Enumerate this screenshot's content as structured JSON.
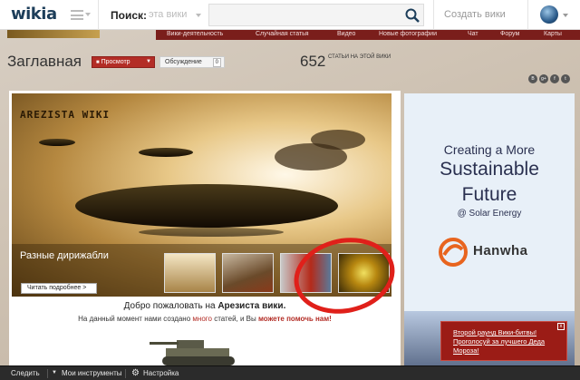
{
  "topbar": {
    "logo": "wikia",
    "search_label": "Поиск:",
    "search_scope": "эта вики",
    "search_placeholder": "",
    "create_wiki": "Создать вики"
  },
  "wiki_nav": {
    "items": [
      "Вики-деятельность",
      "Случайная статья",
      "Видео",
      "Новые фотографии",
      "Чат",
      "Форум",
      "Карты"
    ]
  },
  "header": {
    "page_title": "Заглавная",
    "view_button": "Просмотр",
    "discussion_button": "Обсуждение",
    "discussion_count": "0",
    "article_count": "652",
    "article_count_label": "СТАТЬИ НА ЭТОЙ ВИКИ",
    "social_icons": [
      "vk-icon",
      "google-plus-icon",
      "facebook-icon",
      "twitter-icon"
    ]
  },
  "slider": {
    "title": "AREZISTA WIKI",
    "caption": "Разные дирижабли",
    "read_more": "Читать подробнее >"
  },
  "welcome": {
    "prefix": "Добро пожаловать на ",
    "wiki_name": "Арезиста вики.",
    "sub_prefix": "На данный момент нами создано ",
    "sub_link1": "много",
    "sub_middle": " статей, и Вы ",
    "sub_link2": "можете помочь нам!"
  },
  "ad": {
    "line1": "Creating a More",
    "line2": "Sustainable",
    "line3": "Future",
    "line4": "@ Solar Energy",
    "brand": "Hanwha"
  },
  "notification": {
    "text": "Второй раунд Вики-битвы! Проголосуй за лучшего Деда Мороза!",
    "close": "x"
  },
  "toolbar": {
    "follow": "Следить",
    "my_tools": "Мои инструменты",
    "settings": "Настройка"
  },
  "colors": {
    "accent": "#b32d26",
    "nav_bg": "#7a1e1b",
    "toolbar_bg": "#2b2b2b",
    "annotation_circle": "#e0201a"
  }
}
